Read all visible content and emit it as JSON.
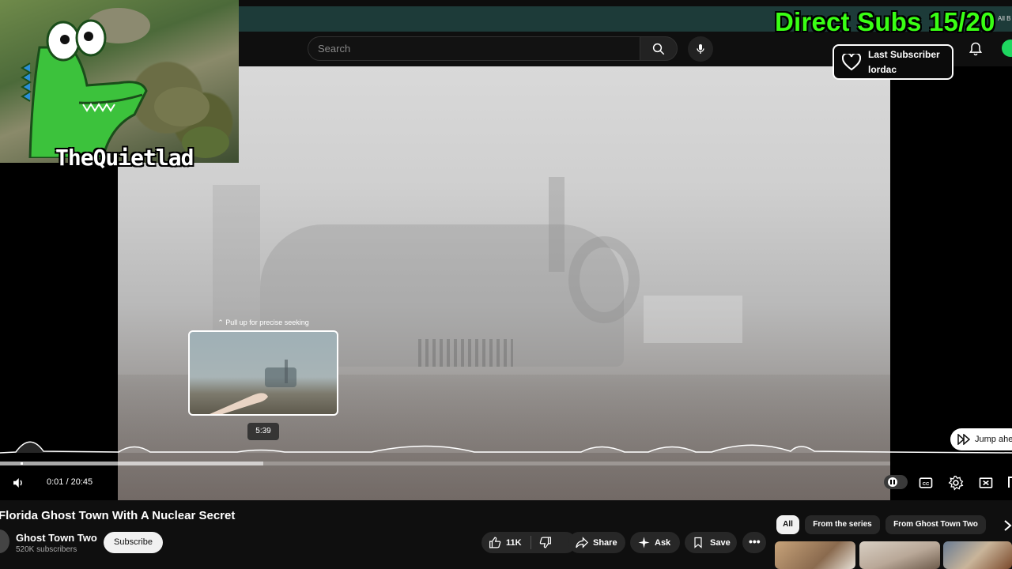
{
  "overlay": {
    "subs_counter": "Direct Subs 15/20",
    "tiny_label": "All B",
    "last_subscriber_title": "Last Subscriber",
    "last_subscriber_name": "lordac",
    "streamer_name": "TheQuietlad"
  },
  "header": {
    "search_placeholder": "Search"
  },
  "player": {
    "seek_hint": "Pull up for precise seeking",
    "preview_time": "5:39",
    "current_time": "0:01",
    "duration": "20:45",
    "time_display": "0:01 / 20:45",
    "jump_label": "Jump ahead",
    "progress_played_fraction": 0.001,
    "progress_buffered_fraction": 0.296
  },
  "video": {
    "title": "Florida Ghost Town With A Nuclear Secret",
    "channel_name": "Ghost Town Two",
    "channel_subs": "520K subscribers",
    "subscribe_label": "Subscribe",
    "like_count": "11K",
    "share_label": "Share",
    "ask_label": "Ask",
    "save_label": "Save"
  },
  "chips": {
    "items": [
      "All",
      "From the series",
      "From Ghost Town Two"
    ],
    "active": "All"
  },
  "colors": {
    "accent_green": "#39ff14",
    "background": "#0f0f0f"
  }
}
